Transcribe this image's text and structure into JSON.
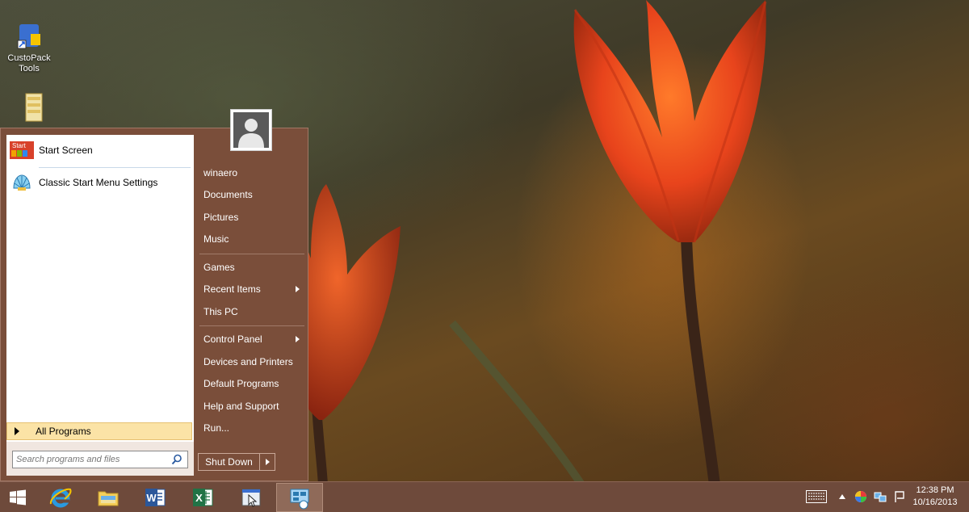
{
  "desktop": {
    "icons": [
      {
        "label": "CustoPack Tools",
        "icon": "custopack-tools-icon"
      },
      {
        "label": "",
        "icon": "folder-icon"
      }
    ]
  },
  "start_menu": {
    "pinned": [
      {
        "label": "Start Screen",
        "icon": "start-screen-icon",
        "icon_text": "Start"
      },
      {
        "label": "Classic Start Menu Settings",
        "icon": "shell-icon"
      }
    ],
    "all_programs": "All Programs",
    "search_placeholder": "Search programs and files",
    "user_avatar": "user-avatar-icon",
    "right_items": [
      {
        "label": "winaero",
        "submenu": false
      },
      {
        "label": "Documents",
        "submenu": false
      },
      {
        "label": "Pictures",
        "submenu": false
      },
      {
        "label": "Music",
        "submenu": false
      },
      {
        "label": "Games",
        "submenu": false
      },
      {
        "label": "Recent Items",
        "submenu": true
      },
      {
        "label": "This PC",
        "submenu": false
      },
      {
        "label": "Control Panel",
        "submenu": true
      },
      {
        "label": "Devices and Printers",
        "submenu": false
      },
      {
        "label": "Default Programs",
        "submenu": false
      },
      {
        "label": "Help and Support",
        "submenu": false
      },
      {
        "label": "Run...",
        "submenu": false
      }
    ],
    "shutdown_label": "Shut Down"
  },
  "taskbar": {
    "buttons": [
      {
        "icon": "windows-start-icon"
      },
      {
        "icon": "internet-explorer-icon"
      },
      {
        "icon": "file-explorer-icon"
      },
      {
        "icon": "word-icon",
        "letter": "W"
      },
      {
        "icon": "excel-icon",
        "letter": "X"
      },
      {
        "icon": "desktop-app-icon"
      },
      {
        "icon": "classic-shell-icon",
        "active": true
      }
    ],
    "tray": [
      "keyboard-icon",
      "show-hidden-icons-chevron",
      "color-wheel-icon",
      "network-icon",
      "action-center-flag-icon"
    ],
    "time": "12:38 PM",
    "date": "10/16/2013"
  },
  "colors": {
    "menu_brown": "#7a4e3a",
    "taskbar": "#6e4a3b",
    "all_programs_highlight": "#fbe3a6",
    "tulip": "#e8441c"
  }
}
